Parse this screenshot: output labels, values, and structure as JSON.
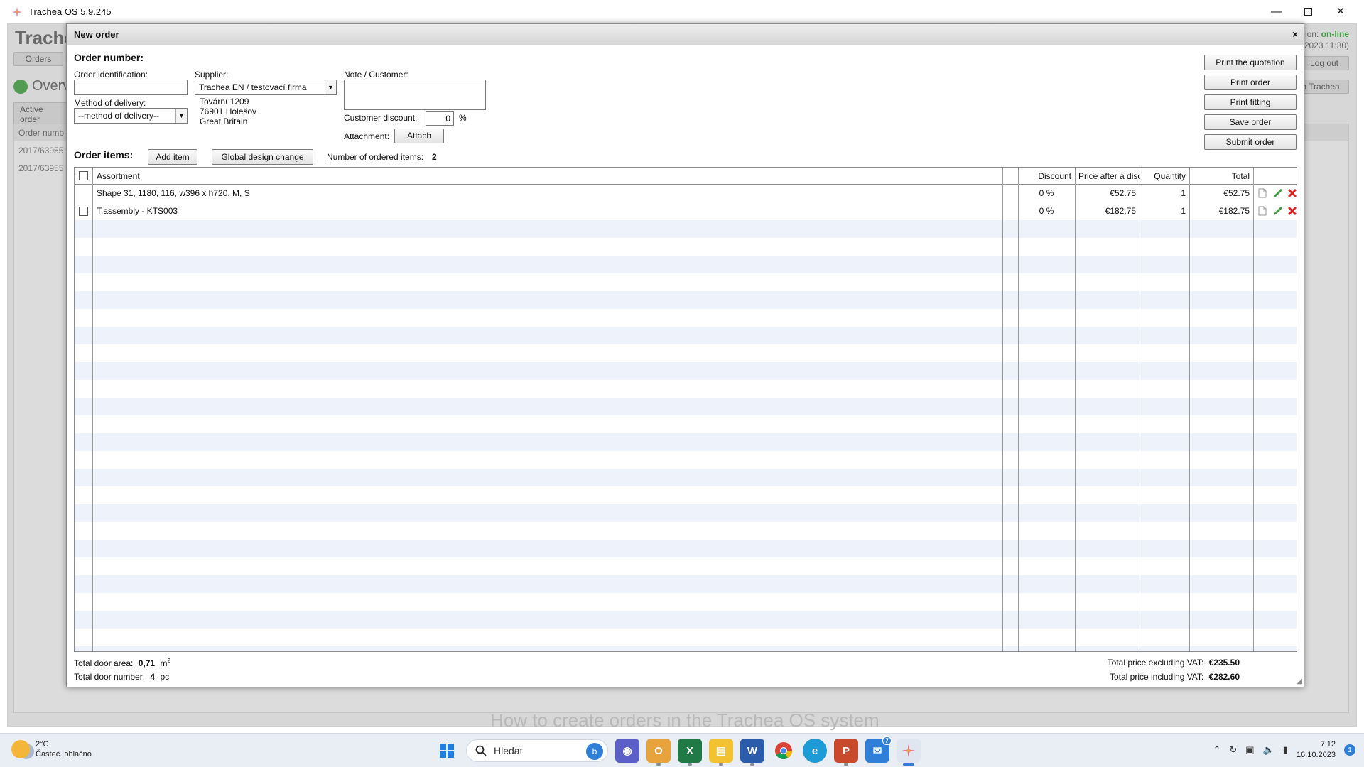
{
  "window": {
    "title": "Trachea OS 5.9.245"
  },
  "background_app": {
    "brand": "Trache",
    "orders_button": "Orders",
    "status_prefix": "ion:",
    "status_value": "on-line",
    "status_time": "2023 11:30)",
    "logout": "Log out",
    "overview": "Overv",
    "active_orders": "Active order",
    "trachea_button": "n Trachea",
    "grid_header": "Order numb",
    "grid_rows": [
      "2017/63955",
      "2017/63955"
    ],
    "watermark": "How to create orders in the Trachea OS system"
  },
  "modal": {
    "title": "New order",
    "close": "×",
    "order_number_label": "Order number:",
    "order_identification_label": "Order identification:",
    "order_identification_value": "",
    "supplier_label": "Supplier:",
    "supplier_value": "Trachea EN / testovací firma",
    "supplier_address": [
      "Tovární 1209",
      "76901 Holešov",
      "Great Britain"
    ],
    "delivery_label": "Method of delivery:",
    "delivery_value": "--method of delivery--",
    "note_label": "Note / Customer:",
    "customer_discount_label": "Customer discount:",
    "customer_discount_value": "0",
    "percent": "%",
    "attachment_label": "Attachment:",
    "attach_button": "Attach",
    "buttons": {
      "print_quotation": "Print the quotation",
      "print_order": "Print order",
      "print_fitting": "Print fitting",
      "save_order": "Save order",
      "submit_order": "Submit order"
    },
    "order_items_label": "Order items:",
    "add_item": "Add item",
    "global_design_change": "Global design change",
    "number_items_label": "Number of ordered items:",
    "number_items_value": "2",
    "table": {
      "headers": {
        "assortment": "Assortment",
        "discount": "Discount",
        "price": "Price after a discount",
        "quantity": "Quantity",
        "total": "Total"
      },
      "rows": [
        {
          "assortment": "Shape 31, 1180, 116, w396 x h720, M, S",
          "discount": "0 %",
          "price": "€52.75",
          "quantity": "1",
          "total": "€52.75"
        },
        {
          "assortment": "T.assembly - KTS003",
          "discount": "0 %",
          "price": "€182.75",
          "quantity": "1",
          "total": "€182.75"
        }
      ]
    },
    "footer": {
      "door_area_label": "Total door area:",
      "door_area_value": "0,71",
      "door_area_unit": "m",
      "door_area_unit_sup": "2",
      "door_number_label": "Total door number:",
      "door_number_value": "4",
      "door_number_unit": "pc",
      "excl_vat_label": "Total price excluding VAT:",
      "excl_vat_value": "€235.50",
      "incl_vat_label": "Total price including VAT:",
      "incl_vat_value": "€282.60"
    }
  },
  "taskbar": {
    "weather_temp": "2°C",
    "weather_desc": "Částeč. oblačno",
    "search_placeholder": "Hledat",
    "time": "7:12",
    "date": "16.10.2023",
    "notification_count": "1",
    "mail_badge": "7"
  },
  "colors": {
    "online": "#3aa63a",
    "delete": "#d92020",
    "edit": "#3f9a3f",
    "row_alt": "#edf2fb"
  }
}
